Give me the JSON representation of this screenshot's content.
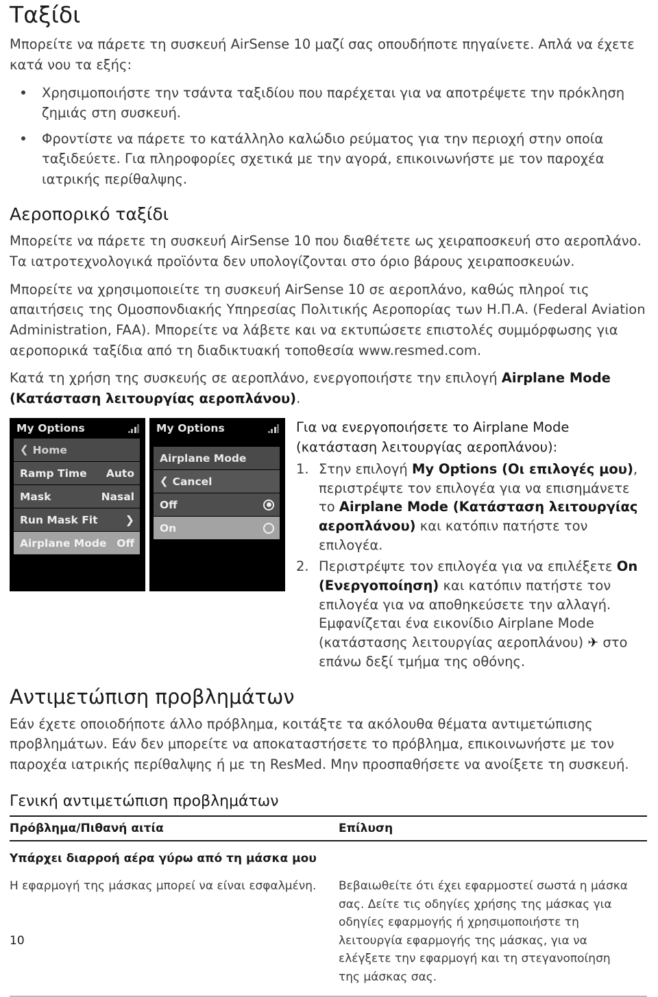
{
  "document": {
    "title": "Ταξίδι",
    "page_number": "10"
  },
  "intro": {
    "paragraph": "Μπορείτε να πάρετε τη συσκευή AirSense 10 μαζί σας οπουδήποτε πηγαίνετε. Απλά να έχετε κατά νου τα εξής:",
    "bullets": [
      "Χρησιμοποιήστε την τσάντα ταξιδίου που παρέχεται για να αποτρέψετε την πρόκληση ζημιάς στη συσκευή.",
      "Φροντίστε να πάρετε το κατάλληλο καλώδιο ρεύματος για την περιοχή στην οποία ταξιδεύετε. Για πληροφορίες σχετικά με την αγορά, επικοινωνήστε με τον παροχέα ιατρικής περίθαλψης."
    ]
  },
  "air_travel": {
    "heading": "Αεροπορικό ταξίδι",
    "p1": "Μπορείτε να πάρετε τη συσκευή AirSense 10 που διαθέτετε ως χειραποσκευή στο αεροπλάνο. Τα ιατροτεχνολογικά προϊόντα δεν υπολογίζονται στο όριο βάρους χειραποσκευών.",
    "p2": "Μπορείτε να χρησιμοποιείτε τη συσκευή AirSense 10 σε αεροπλάνο, καθώς πληροί τις απαιτήσεις της Ομοσπονδιακής Υπηρεσίας Πολιτικής Αεροπορίας των Η.Π.Α. (Federal Aviation Administration, FAA). Μπορείτε να λάβετε και να εκτυπώσετε επιστολές συμμόρφωσης για αεροπορικά ταξίδια από τη διαδικτυακή τοποθεσία www.resmed.com.",
    "p3_before": "Κατά τη χρήση της συσκευής σε αεροπλάνο, ενεργοποιήστε την επιλογή ",
    "p3_bold": "Airplane Mode (Κατάσταση λειτουργίας αεροπλάνου)",
    "p3_after": "."
  },
  "screens": {
    "screen1": {
      "header_title": "My Options",
      "signal_icon": "signal-bars-icon",
      "rows": [
        {
          "label": "Home",
          "value": "",
          "icon": "chevron-left-icon",
          "state": "dim"
        },
        {
          "label": "Ramp Time",
          "value": "Auto",
          "icon": "",
          "state": "normal"
        },
        {
          "label": "Mask",
          "value": "Nasal",
          "icon": "",
          "state": "normal"
        },
        {
          "label": "Run Mask Fit",
          "value": "",
          "icon": "chevron-right-icon",
          "state": "normal"
        },
        {
          "label": "Airplane Mode",
          "value": "Off",
          "icon": "",
          "state": "highlighted"
        }
      ]
    },
    "screen2": {
      "header_title": "My Options",
      "signal_icon": "signal-bars-icon",
      "menu_title": "Airplane Mode",
      "rows": [
        {
          "label": "Cancel",
          "icon": "chevron-left-icon",
          "state": "dim",
          "radio": "none"
        },
        {
          "label": "Off",
          "icon": "",
          "state": "normal",
          "radio": "selected"
        },
        {
          "label": "On",
          "icon": "",
          "state": "highlighted",
          "radio": "unselected"
        }
      ]
    }
  },
  "steps": {
    "intro": "Για να ενεργοποιήσετε το Airplane Mode (κατάσταση λειτουργίας αεροπλάνου):",
    "items": [
      {
        "s1": "Στην επιλογή ",
        "b1": "My Options (Οι επιλογές μου)",
        "s2": ", περιστρέψτε τον επιλογέα για να επισημάνετε το ",
        "b2": "Airplane Mode (Κατάσταση λειτουργίας αεροπλάνου)",
        "s3": " και κατόπιν πατήστε τον επιλογέα."
      },
      {
        "s1": "Περιστρέψτε τον επιλογέα για να επιλέξετε ",
        "b1": "On (Ενεργοποίηση)",
        "s2": " και κατόπιν πατήστε τον επιλογέα για να αποθηκεύσετε την αλλαγή. Εμφανίζεται ένα εικονίδιο Airplane Mode (κατάστασης λειτουργίας αεροπλάνου) ",
        "icon": "✈",
        "s3": " στο επάνω δεξί τμήμα της οθόνης."
      }
    ]
  },
  "troubleshooting": {
    "heading": "Αντιμετώπιση προβλημάτων",
    "paragraph": "Εάν έχετε οποιοδήποτε άλλο πρόβλημα, κοιτάξτε τα ακόλουθα θέματα αντιμετώπισης προβλημάτων. Εάν δεν μπορείτε να αποκαταστήσετε το πρόβλημα, επικοινωνήστε με τον παροχέα ιατρικής περίθαλψης ή με τη ResMed. Μην προσπαθήσετε να ανοίξετε τη συσκευή.",
    "subheading": "Γενική αντιμετώπιση προβλημάτων",
    "table": {
      "headers": [
        "Πρόβλημα/Πιθανή αιτία",
        "Επίλυση"
      ],
      "group_row": "Υπάρχει διαρροή αέρα γύρω από τη μάσκα μου",
      "rows": [
        {
          "problem": "Η εφαρμογή της μάσκας μπορεί να είναι εσφαλμένη.",
          "solution": "Βεβαιωθείτε ότι έχει εφαρμοστεί σωστά η μάσκα σας. Δείτε τις οδηγίες χρήσης της μάσκας για οδηγίες εφαρμογής ή χρησιμοποιήστε τη λειτουργία εφαρμογής της μάσκας, για να ελέγξετε την εφαρμογή και τη στεγανοποίηση της μάσκας σας."
        }
      ]
    }
  }
}
